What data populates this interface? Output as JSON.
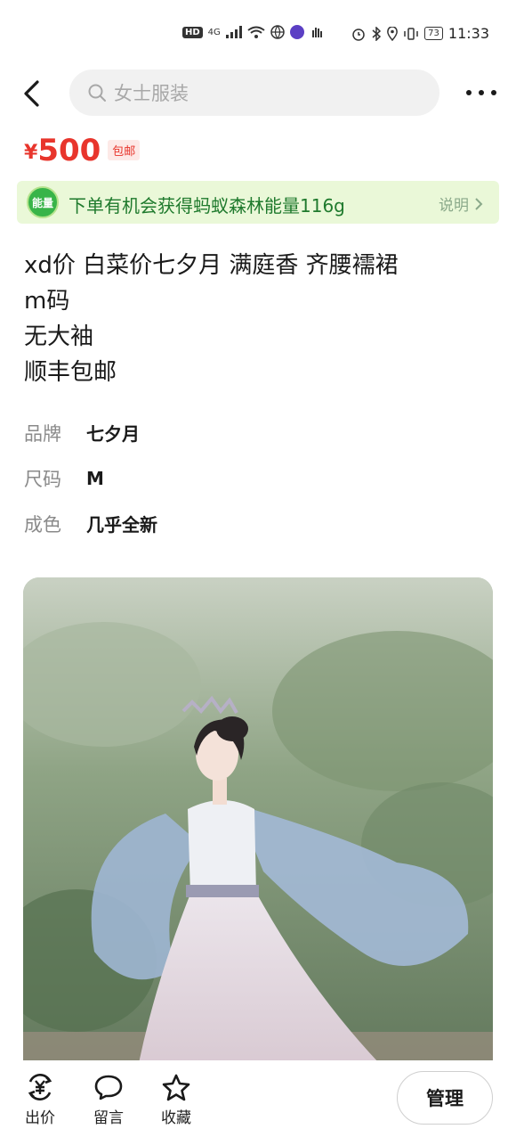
{
  "status_bar": {
    "hd": "HD",
    "net": "4G",
    "battery": "73",
    "time": "11:33"
  },
  "header": {
    "search_placeholder": "女士服装"
  },
  "price": {
    "currency": "¥",
    "amount": "500",
    "free_shipping": "包邮"
  },
  "energy_banner": {
    "badge": "能量",
    "text": "下单有机会获得蚂蚁森林能量116g",
    "link": "说明"
  },
  "description": {
    "lines": [
      "xd价 白菜价七夕月 满庭香 齐腰襦裙",
      "m码",
      "无大袖",
      "顺丰包邮"
    ]
  },
  "attributes": [
    {
      "label": "品牌",
      "value": "七夕月"
    },
    {
      "label": "尺码",
      "value": "M"
    },
    {
      "label": "成色",
      "value": "几乎全新"
    }
  ],
  "bottom_bar": {
    "offer": "出价",
    "comment": "留言",
    "favorite": "收藏",
    "manage": "管理"
  },
  "colors": {
    "price_red": "#e8352c",
    "energy_green": "#38b449",
    "energy_bg": "#eaf8d8"
  }
}
